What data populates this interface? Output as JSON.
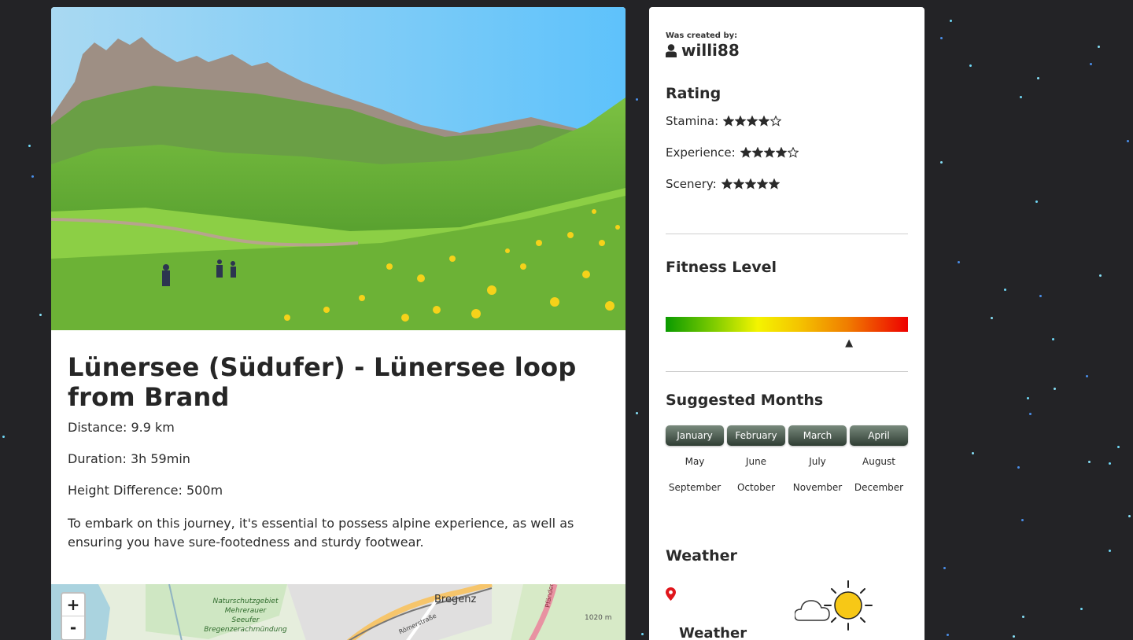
{
  "trail": {
    "title": "Lünersee (Südufer) - Lünersee loop from Brand",
    "distance": "Distance: 9.9 km",
    "duration": "Duration: 3h 59min",
    "height": "Height Difference: 500m",
    "description": "To embark on this journey, it's essential to possess alpine experience, as well as ensuring you have sure-footedness and sturdy footwear."
  },
  "map": {
    "zoom_in": "+",
    "zoom_out": "-",
    "labels": {
      "city": "Bregenz",
      "reserve_1": "Naturschutzgebiet",
      "reserve_2": "Mehrerauer",
      "reserve_3": "Seeufer",
      "reserve_4": "Bregenzerachmündung",
      "street": "Römerstraße",
      "elevation": "1020 m",
      "road": "Pfänder"
    }
  },
  "creator": {
    "label": "Was created by:",
    "name": "willi88",
    "icon": "user-icon"
  },
  "rating": {
    "heading": "Rating",
    "items": [
      {
        "label": "Stamina:",
        "stars": 4,
        "max": 5
      },
      {
        "label": "Experience:",
        "stars": 4,
        "max": 5
      },
      {
        "label": "Scenery:",
        "stars": 5,
        "max": 5
      }
    ]
  },
  "fitness": {
    "heading": "Fitness Level",
    "level": 0.76,
    "marker": "▲"
  },
  "months": {
    "heading": "Suggested Months",
    "items": [
      {
        "name": "January",
        "active": true
      },
      {
        "name": "February",
        "active": true
      },
      {
        "name": "March",
        "active": true
      },
      {
        "name": "April",
        "active": true
      },
      {
        "name": "May",
        "active": false
      },
      {
        "name": "June",
        "active": false
      },
      {
        "name": "July",
        "active": false
      },
      {
        "name": "August",
        "active": false
      },
      {
        "name": "September",
        "active": false
      },
      {
        "name": "October",
        "active": false
      },
      {
        "name": "November",
        "active": false
      },
      {
        "name": "December",
        "active": false
      }
    ]
  },
  "weather": {
    "heading": "Weather",
    "label": "Weather",
    "icon": "partly-sunny-icon",
    "pin_icon": "location-pin-icon"
  },
  "colors": {
    "background": "#232326",
    "month_active": "#3f4d43",
    "pin": "#e0161c",
    "sun": "#f7c816"
  }
}
